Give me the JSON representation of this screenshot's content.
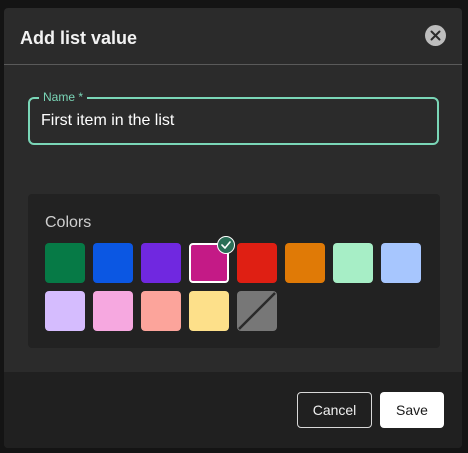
{
  "dialog": {
    "title": "Add list value",
    "close_icon": "close-circle-icon"
  },
  "name_field": {
    "label": "Name *",
    "value": "First item in the list"
  },
  "colors": {
    "label": "Colors",
    "swatches": [
      {
        "name": "dark-green",
        "color": "#067a46"
      },
      {
        "name": "blue",
        "color": "#0b57e3"
      },
      {
        "name": "purple",
        "color": "#7028e0"
      },
      {
        "name": "magenta",
        "color": "#c41a86",
        "selected": true
      },
      {
        "name": "red",
        "color": "#df1f13"
      },
      {
        "name": "orange",
        "color": "#e07a06"
      },
      {
        "name": "light-green",
        "color": "#a7eec6"
      },
      {
        "name": "light-blue",
        "color": "#a7c6fe"
      },
      {
        "name": "lavender",
        "color": "#d5bcfe"
      },
      {
        "name": "pink",
        "color": "#f6a8e0"
      },
      {
        "name": "salmon",
        "color": "#fca49b"
      },
      {
        "name": "yellow",
        "color": "#fde08a"
      },
      {
        "name": "no-color",
        "color": "#777777",
        "icon": "slash-icon"
      }
    ]
  },
  "footer": {
    "cancel_label": "Cancel",
    "save_label": "Save"
  },
  "accent_color": "#7ad6b7"
}
